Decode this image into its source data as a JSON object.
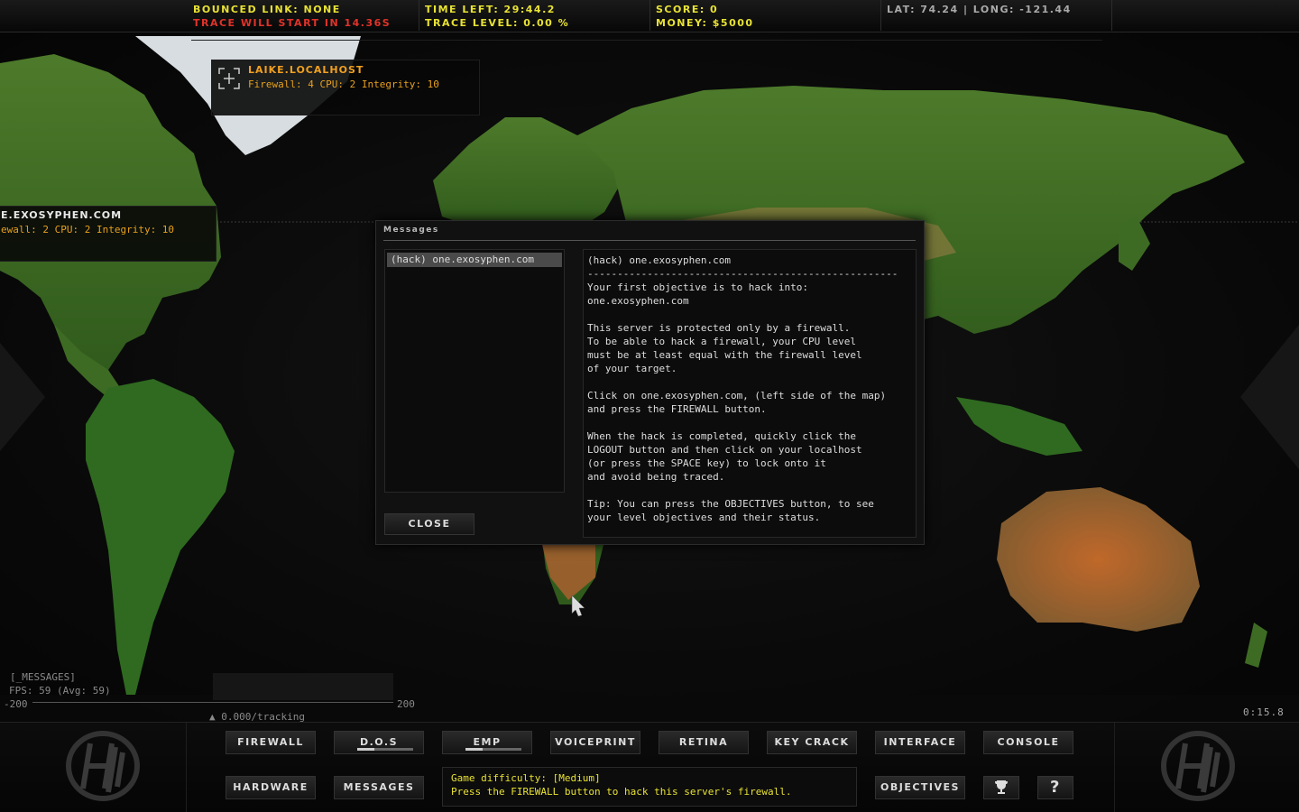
{
  "topbar": {
    "bounced_link": "Bounced link: none",
    "trace_start": "Trace will start in 14.36s",
    "time_left": "Time left: 29:44.2",
    "trace_level": "Trace level: 0.00 %",
    "score": "Score: 0",
    "money": "Money: $5000",
    "lat": "Lat: 74.24",
    "long": "Long: -121.44"
  },
  "servers": [
    {
      "name": "LAIKE.LOCALHOST",
      "stats": "Firewall: 4 CPU: 2 Integrity: 10",
      "name_color": "#f0a020"
    },
    {
      "name": "E.EXOSYPHEN.COM",
      "stats": "ewall: 2 CPU: 2 Integrity: 10",
      "name_color": "#e8e8e8"
    }
  ],
  "messages_dialog": {
    "title": "Messages",
    "list_items": [
      "(hack) one.exosyphen.com"
    ],
    "close_label": "CLOSE",
    "body_lines": [
      "(hack) one.exosyphen.com",
      "----------------------------------------------------",
      "Your first objective is to hack into:",
      "one.exosyphen.com",
      "",
      "This server is protected only by a firewall.",
      "To be able to hack a firewall, your CPU level",
      "must be at least equal with the firewall level",
      "of your target.",
      "",
      "Click on one.exosyphen.com, (left side of the map)",
      "and press the FIREWALL button.",
      "",
      "When the hack is completed, quickly click the",
      "LOGOUT button and then click on your localhost",
      "(or press the SPACE key) to lock onto it",
      "and avoid being traced.",
      "",
      "Tip: You can press the OBJECTIVES button, to see",
      "your level objectives and their status."
    ]
  },
  "debug": {
    "messages_tag": "[_MESSAGES]",
    "fps": "FPS:  59 (Avg: 59)",
    "scale_min": "-200",
    "scale_max": "200",
    "tracking": "0.000/tracking",
    "timer": "0:15.8"
  },
  "buttons": {
    "firewall": "FIREWALL",
    "dos": "D.O.S",
    "emp": "EMP",
    "voiceprint": "VOICEPRINT",
    "retina": "RETINA",
    "key_crack": "KEY CRACK",
    "interface": "INTERFACE",
    "console": "CONSOLE",
    "hardware": "HARDWARE",
    "messages": "MESSAGES",
    "objectives": "OBJECTIVES",
    "trophy_icon": "trophy-icon",
    "help": "?"
  },
  "progress": {
    "dos": 0.3,
    "emp": 0.3
  },
  "status_lines": [
    "Game difficulty: [Medium]",
    "Press the FIREWALL button to hack this server's firewall."
  ],
  "colors": {
    "accent_yellow": "#e8e233",
    "warning_red": "#e0332a",
    "server_orange": "#e8a01c"
  }
}
